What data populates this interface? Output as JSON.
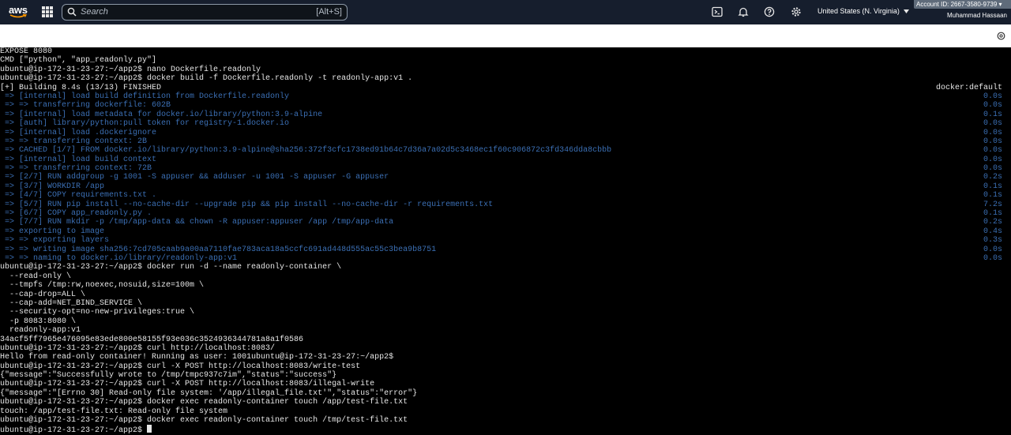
{
  "topbar": {
    "logo_text": "aws",
    "search_placeholder": "Search",
    "search_shortcut": "[Alt+S]",
    "region": "United States (N. Virginia)",
    "account": "Account ID: 2667-3580-9739",
    "username": "Muhammad Hassaan",
    "icons": [
      "services-grid-icon",
      "search-icon",
      "cloudshell-icon",
      "bell-icon",
      "help-icon",
      "gear-icon",
      "caret-down-icon"
    ]
  },
  "terminal": {
    "lines": [
      {
        "text": "EXPOSE 8080",
        "style": "w"
      },
      {
        "text": "CMD [\"python\", \"app_readonly.py\"]",
        "style": "w"
      },
      {
        "text": "ubuntu@ip-172-31-23-27:~/app2$ nano Dockerfile.readonly",
        "style": "w"
      },
      {
        "text": "ubuntu@ip-172-31-23-27:~/app2$ docker build -f Dockerfile.readonly -t readonly-app:v1 .",
        "style": "w"
      },
      {
        "text": "[+] Building 8.4s (13/13) FINISHED",
        "style": "w",
        "right": "docker:default"
      },
      {
        "text": " => [internal] load build definition from Dockerfile.readonly",
        "style": "b",
        "right": "0.0s"
      },
      {
        "text": " => => transferring dockerfile: 602B",
        "style": "b",
        "right": "0.0s"
      },
      {
        "text": " => [internal] load metadata for docker.io/library/python:3.9-alpine",
        "style": "b",
        "right": "0.1s"
      },
      {
        "text": " => [auth] library/python:pull token for registry-1.docker.io",
        "style": "b",
        "right": "0.0s"
      },
      {
        "text": " => [internal] load .dockerignore",
        "style": "b",
        "right": "0.0s"
      },
      {
        "text": " => => transferring context: 2B",
        "style": "b",
        "right": "0.0s"
      },
      {
        "text": " => CACHED [1/7] FROM docker.io/library/python:3.9-alpine@sha256:372f3cfc1738ed91b64c7d36a7a02d5c3468ec1f60c906872c3fd346dda8cbbb",
        "style": "b",
        "right": "0.0s"
      },
      {
        "text": " => [internal] load build context",
        "style": "b",
        "right": "0.0s"
      },
      {
        "text": " => => transferring context: 72B",
        "style": "b",
        "right": "0.0s"
      },
      {
        "text": " => [2/7] RUN addgroup -g 1001 -S appuser && adduser -u 1001 -S appuser -G appuser",
        "style": "b",
        "right": "0.2s"
      },
      {
        "text": " => [3/7] WORKDIR /app",
        "style": "b",
        "right": "0.1s"
      },
      {
        "text": " => [4/7] COPY requirements.txt .",
        "style": "b",
        "right": "0.1s"
      },
      {
        "text": " => [5/7] RUN pip install --no-cache-dir --upgrade pip && pip install --no-cache-dir -r requirements.txt",
        "style": "b",
        "right": "7.2s"
      },
      {
        "text": " => [6/7] COPY app_readonly.py .",
        "style": "b",
        "right": "0.1s"
      },
      {
        "text": " => [7/7] RUN mkdir -p /tmp/app-data && chown -R appuser:appuser /app /tmp/app-data",
        "style": "b",
        "right": "0.2s"
      },
      {
        "text": " => exporting to image",
        "style": "b",
        "right": "0.4s"
      },
      {
        "text": " => => exporting layers",
        "style": "b",
        "right": "0.3s"
      },
      {
        "text": " => => writing image sha256:7cd705caab9a00aa7110fae783aca18a5ccfc691ad448d555ac55c3bea9b8751",
        "style": "b",
        "right": "0.0s"
      },
      {
        "text": " => => naming to docker.io/library/readonly-app:v1",
        "style": "b",
        "right": "0.0s"
      },
      {
        "text": "ubuntu@ip-172-31-23-27:~/app2$ docker run -d --name readonly-container \\",
        "style": "w"
      },
      {
        "text": "  --read-only \\",
        "style": "w"
      },
      {
        "text": "  --tmpfs /tmp:rw,noexec,nosuid,size=100m \\",
        "style": "w"
      },
      {
        "text": "  --cap-drop=ALL \\",
        "style": "w"
      },
      {
        "text": "  --cap-add=NET_BIND_SERVICE \\",
        "style": "w"
      },
      {
        "text": "  --security-opt=no-new-privileges:true \\",
        "style": "w"
      },
      {
        "text": "  -p 8083:8080 \\",
        "style": "w"
      },
      {
        "text": "  readonly-app:v1",
        "style": "w"
      },
      {
        "text": "34acf5ff7965e476095e83ede800e58155f93e036c3524936344781a8a1f0586",
        "style": "w"
      },
      {
        "text": "ubuntu@ip-172-31-23-27:~/app2$ curl http://localhost:8083/",
        "style": "w"
      },
      {
        "text": "Hello from read-only container! Running as user: 1001ubuntu@ip-172-31-23-27:~/app2$",
        "style": "w"
      },
      {
        "text": "ubuntu@ip-172-31-23-27:~/app2$ curl -X POST http://localhost:8083/write-test",
        "style": "w"
      },
      {
        "text": "{\"message\":\"Successfully wrote to /tmp/tmpc937c7im\",\"status\":\"success\"}",
        "style": "w"
      },
      {
        "text": "ubuntu@ip-172-31-23-27:~/app2$ curl -X POST http://localhost:8083/illegal-write",
        "style": "w"
      },
      {
        "text": "{\"message\":\"[Errno 30] Read-only file system: '/app/illegal_file.txt'\",\"status\":\"error\"}",
        "style": "w"
      },
      {
        "text": "ubuntu@ip-172-31-23-27:~/app2$ docker exec readonly-container touch /app/test-file.txt",
        "style": "w"
      },
      {
        "text": "touch: /app/test-file.txt: Read-only file system",
        "style": "w"
      },
      {
        "text": "ubuntu@ip-172-31-23-27:~/app2$ docker exec readonly-container touch /tmp/test-file.txt",
        "style": "w"
      },
      {
        "text": "ubuntu@ip-172-31-23-27:~/app2$ ",
        "style": "w",
        "cursor": true
      }
    ]
  },
  "colors": {
    "topbar_bg": "#161e2d",
    "terminal_bg": "#000000",
    "terminal_text": "#e6e6e6",
    "build_step_text": "#3b6fb4"
  }
}
